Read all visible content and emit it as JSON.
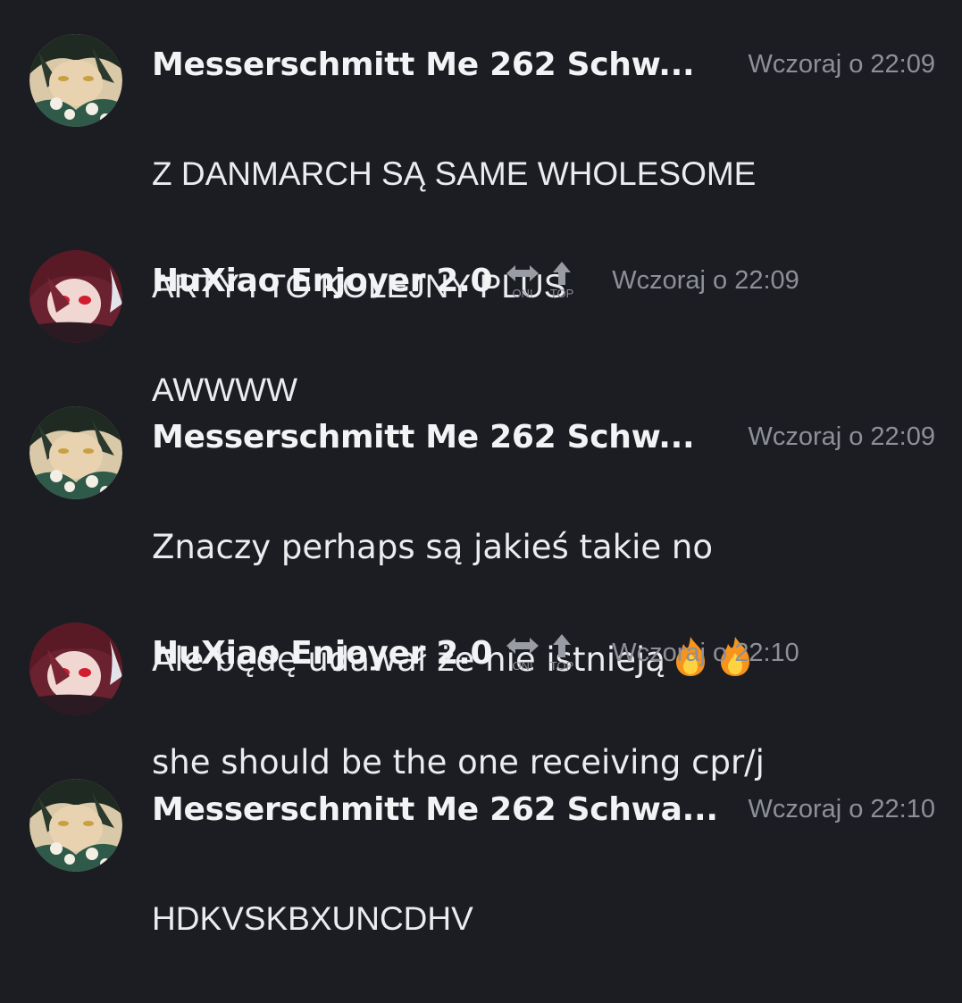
{
  "messages": [
    {
      "author": "Messerschmitt Me 262 Schw...",
      "timestamp": "Wczoraj o 22:09",
      "lines": [
        "Z DANMARCH SĄ SAME WHOLESOME",
        "ARTY I TO KOLEJNY PLUS"
      ],
      "avatar": "avatar-green-dark-hair"
    },
    {
      "author": "HuXiao Enjoyer 2.0",
      "timestamp": "Wczoraj o 22:09",
      "tags": [
        {
          "icon": "on-arrow-icon",
          "label": "ON!"
        },
        {
          "icon": "top-arrow-icon",
          "label": "TOP"
        }
      ],
      "lines": [
        "AWWWW"
      ],
      "avatar": "avatar-red-eyes-hair"
    },
    {
      "author": "Messerschmitt Me 262 Schw...",
      "timestamp": "Wczoraj o 22:09",
      "lines": [
        "Znaczy perhaps są jakieś takie no",
        "Ale będę udawał że nie istnieją"
      ],
      "emoji": [
        "fire-emoji",
        "fire-emoji"
      ],
      "avatar": "avatar-green-dark-hair"
    },
    {
      "author": "HuXiao Enjoyer 2.0",
      "timestamp": "Wczoraj o 22:10",
      "tags": [
        {
          "icon": "on-arrow-icon",
          "label": "ON!"
        },
        {
          "icon": "top-arrow-icon",
          "label": "TOP"
        }
      ],
      "lines": [
        "she should be the one receiving cpr/j"
      ],
      "avatar": "avatar-red-eyes-hair"
    },
    {
      "author": "Messerschmitt Me 262 Schwa...",
      "timestamp": "Wczoraj o 22:10",
      "lines": [
        "HDKVSKBXUNCDHV"
      ],
      "avatar": "avatar-green-dark-hair"
    }
  ],
  "colors": {
    "background": "#1c1d22",
    "author": "#f2f3f5",
    "timestamp": "#8e9099",
    "body": "#ebecef"
  }
}
